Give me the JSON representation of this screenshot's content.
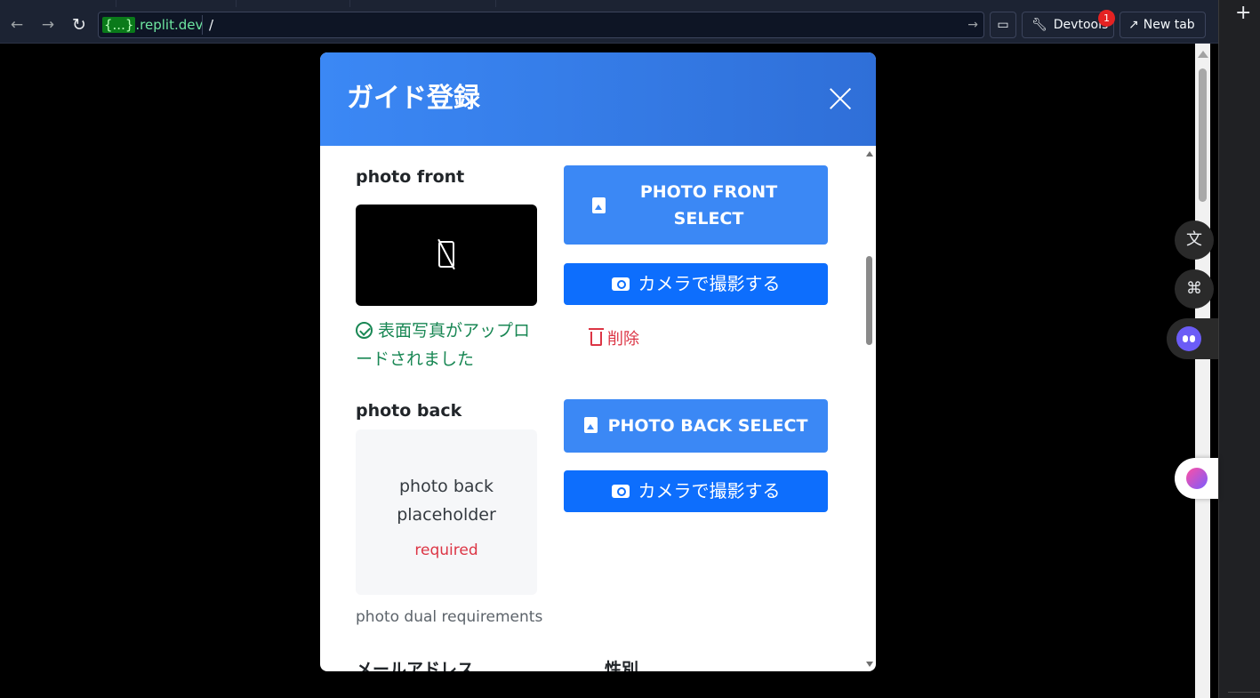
{
  "browser": {
    "url_host_highlight": "{...}",
    "url_host_rest": ".replit.dev",
    "url_path": "/",
    "devtools_label": "Devtools",
    "devtools_badge": "1",
    "new_tab_label": "New tab"
  },
  "modal": {
    "title": "ガイド登録",
    "photo_front": {
      "label": "photo front",
      "select_button": "PHOTO FRONT SELECT",
      "camera_button": "カメラで撮影する",
      "success_message": "表面写真がアップロードされました",
      "delete_button": "削除"
    },
    "photo_back": {
      "label": "photo back",
      "select_button": "PHOTO BACK SELECT",
      "camera_button": "カメラで撮影する",
      "placeholder_text": "photo back placeholder",
      "required_text": "required"
    },
    "requirements_text": "photo dual requirements",
    "next_fields": {
      "email_label": "メールアドレス",
      "gender_label": "性別"
    }
  },
  "colors": {
    "header_gradient_start": "#3b88f5",
    "header_gradient_end": "#2f6fd8",
    "select_button": "#3b88f5",
    "camera_button": "#0d6efd",
    "success": "#198754",
    "danger": "#dc3545"
  }
}
